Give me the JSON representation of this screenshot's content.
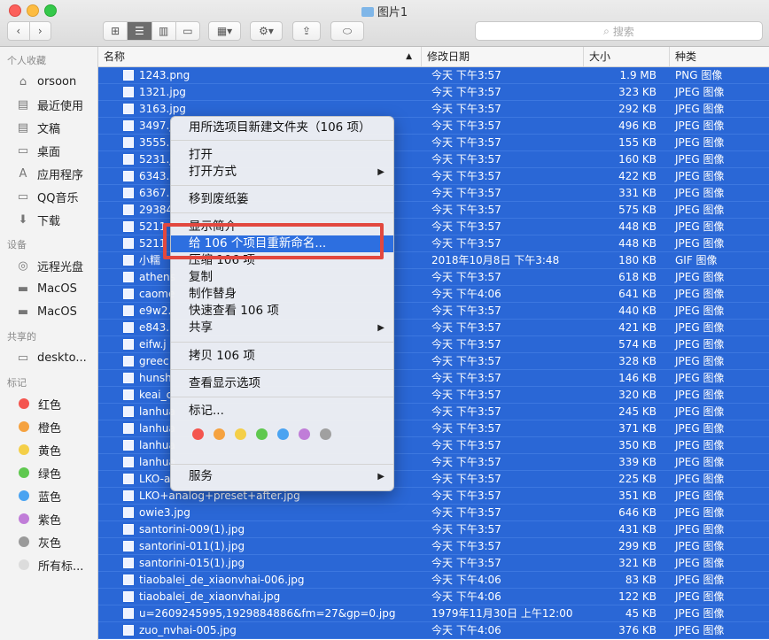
{
  "window": {
    "title": "图片1"
  },
  "toolbar": {
    "search_placeholder": "搜索"
  },
  "sidebar": {
    "favorites_header": "个人收藏",
    "favorites": [
      {
        "label": "orsoon",
        "icon": "home-icon"
      },
      {
        "label": "最近使用",
        "icon": "recents-icon"
      },
      {
        "label": "文稿",
        "icon": "documents-icon"
      },
      {
        "label": "桌面",
        "icon": "desktop-icon"
      },
      {
        "label": "应用程序",
        "icon": "applications-icon"
      },
      {
        "label": "QQ音乐",
        "icon": "folder-icon"
      },
      {
        "label": "下载",
        "icon": "downloads-icon"
      }
    ],
    "devices_header": "设备",
    "devices": [
      {
        "label": "远程光盘",
        "icon": "remote-disc-icon"
      },
      {
        "label": "MacOS",
        "icon": "disk-icon"
      },
      {
        "label": "MacOS",
        "icon": "disk-icon"
      }
    ],
    "shared_header": "共享的",
    "shared": [
      {
        "label": "deskto...",
        "icon": "computer-icon"
      }
    ],
    "tags_header": "标记",
    "tags": [
      {
        "label": "红色",
        "color": "#f4554f"
      },
      {
        "label": "橙色",
        "color": "#f5a240"
      },
      {
        "label": "黄色",
        "color": "#f4cf48"
      },
      {
        "label": "绿色",
        "color": "#5fc84f"
      },
      {
        "label": "蓝色",
        "color": "#4aa3f1"
      },
      {
        "label": "紫色",
        "color": "#c07dd8"
      },
      {
        "label": "灰色",
        "color": "#9a9a9a"
      },
      {
        "label": "所有标...",
        "color": "#dcdcdc"
      }
    ]
  },
  "columns": {
    "name": "名称",
    "date": "修改日期",
    "size": "大小",
    "kind": "种类"
  },
  "files": [
    {
      "name": "1243.png",
      "date": "今天 下午3:57",
      "size": "1.9 MB",
      "kind": "PNG 图像"
    },
    {
      "name": "1321.jpg",
      "date": "今天 下午3:57",
      "size": "323 KB",
      "kind": "JPEG 图像"
    },
    {
      "name": "3163.jpg",
      "date": "今天 下午3:57",
      "size": "292 KB",
      "kind": "JPEG 图像"
    },
    {
      "name": "3497.j",
      "date": "今天 下午3:57",
      "size": "496 KB",
      "kind": "JPEG 图像"
    },
    {
      "name": "3555.",
      "date": "今天 下午3:57",
      "size": "155 KB",
      "kind": "JPEG 图像"
    },
    {
      "name": "5231.j",
      "date": "今天 下午3:57",
      "size": "160 KB",
      "kind": "JPEG 图像"
    },
    {
      "name": "6343.",
      "date": "今天 下午3:57",
      "size": "422 KB",
      "kind": "JPEG 图像"
    },
    {
      "name": "6367.",
      "date": "今天 下午3:57",
      "size": "331 KB",
      "kind": "JPEG 图像"
    },
    {
      "name": "29384",
      "date": "今天 下午3:57",
      "size": "575 KB",
      "kind": "JPEG 图像"
    },
    {
      "name": "5211",
      "date": "今天 下午3:57",
      "size": "448 KB",
      "kind": "JPEG 图像"
    },
    {
      "name": "5211",
      "date": "今天 下午3:57",
      "size": "448 KB",
      "kind": "JPEG 图像"
    },
    {
      "name": "小糯",
      "date": "2018年10月8日 下午3:48",
      "size": "180 KB",
      "kind": "GIF 图像"
    },
    {
      "name": "athens",
      "date": "今天 下午3:57",
      "size": "618 KB",
      "kind": "JPEG 图像"
    },
    {
      "name": "caome",
      "date": "今天 下午4:06",
      "size": "641 KB",
      "kind": "JPEG 图像"
    },
    {
      "name": "e9w2.",
      "date": "今天 下午3:57",
      "size": "440 KB",
      "kind": "JPEG 图像"
    },
    {
      "name": "e843.",
      "date": "今天 下午3:57",
      "size": "421 KB",
      "kind": "JPEG 图像"
    },
    {
      "name": "eifw.j",
      "date": "今天 下午3:57",
      "size": "574 KB",
      "kind": "JPEG 图像"
    },
    {
      "name": "greec",
      "date": "今天 下午3:57",
      "size": "328 KB",
      "kind": "JPEG 图像"
    },
    {
      "name": "hunsh",
      "date": "今天 下午3:57",
      "size": "146 KB",
      "kind": "JPEG 图像"
    },
    {
      "name": "keai_c",
      "date": "今天 下午3:57",
      "size": "320 KB",
      "kind": "JPEG 图像"
    },
    {
      "name": "lanhua",
      "date": "今天 下午3:57",
      "size": "245 KB",
      "kind": "JPEG 图像"
    },
    {
      "name": "lanhua",
      "date": "今天 下午3:57",
      "size": "371 KB",
      "kind": "JPEG 图像"
    },
    {
      "name": "lanhua",
      "date": "今天 下午3:57",
      "size": "350 KB",
      "kind": "JPEG 图像"
    },
    {
      "name": "lanhua",
      "date": "今天 下午3:57",
      "size": "339 KB",
      "kind": "JPEG 图像"
    },
    {
      "name": "LKO-a",
      "date": "今天 下午3:57",
      "size": "225 KB",
      "kind": "JPEG 图像"
    },
    {
      "name": "LKO+analog+preset+after.jpg",
      "date": "今天 下午3:57",
      "size": "351 KB",
      "kind": "JPEG 图像"
    },
    {
      "name": "owie3.jpg",
      "date": "今天 下午3:57",
      "size": "646 KB",
      "kind": "JPEG 图像"
    },
    {
      "name": "santorini-009(1).jpg",
      "date": "今天 下午3:57",
      "size": "431 KB",
      "kind": "JPEG 图像"
    },
    {
      "name": "santorini-011(1).jpg",
      "date": "今天 下午3:57",
      "size": "299 KB",
      "kind": "JPEG 图像"
    },
    {
      "name": "santorini-015(1).jpg",
      "date": "今天 下午3:57",
      "size": "321 KB",
      "kind": "JPEG 图像"
    },
    {
      "name": "tiaobalei_de_xiaonvhai-006.jpg",
      "date": "今天 下午4:06",
      "size": "83 KB",
      "kind": "JPEG 图像"
    },
    {
      "name": "tiaobalei_de_xiaonvhai.jpg",
      "date": "今天 下午4:06",
      "size": "122 KB",
      "kind": "JPEG 图像"
    },
    {
      "name": "u=2609245995,1929884886&fm=27&gp=0.jpg",
      "date": "1979年11月30日 上午12:00",
      "size": "45 KB",
      "kind": "JPEG 图像"
    },
    {
      "name": "zuo_nvhai-005.jpg",
      "date": "今天 下午4:06",
      "size": "376 KB",
      "kind": "JPEG 图像"
    }
  ],
  "context_menu": {
    "new_folder": "用所选项目新建文件夹（106 项）",
    "open": "打开",
    "open_with": "打开方式",
    "move_to_trash": "移到废纸篓",
    "get_info": "显示简介",
    "rename": "给 106 个项目重新命名...",
    "compress": "压缩 106 项",
    "duplicate": "复制",
    "make_alias": "制作替身",
    "quick_look": "快速查看 106 项",
    "share": "共享",
    "copy": "拷贝 106 项",
    "view_options": "查看显示选项",
    "tags": "标记...",
    "services": "服务",
    "tag_colors": [
      "#f4554f",
      "#f5a240",
      "#f4cf48",
      "#5fc84f",
      "#4aa3f1",
      "#c07dd8",
      "#a0a0a0"
    ]
  }
}
